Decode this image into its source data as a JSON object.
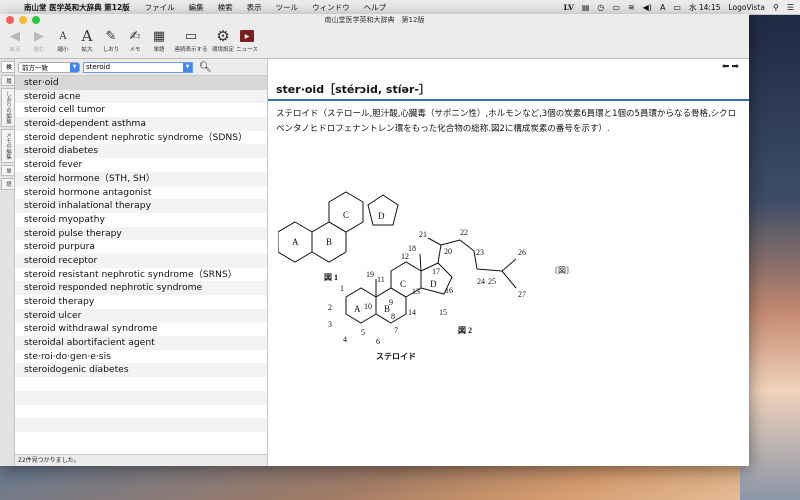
{
  "menubar": {
    "app_name": "南山堂 医学英和大辞典 第12版",
    "menus": [
      "ファイル",
      "編集",
      "検索",
      "表示",
      "ツール",
      "ウィンドウ",
      "ヘルプ"
    ],
    "clock": "水 14:15",
    "right_app": "LogoVista",
    "lv_label": "LV",
    "input_label": "A"
  },
  "window": {
    "title": "南山堂医学英和大辞典　第12版"
  },
  "toolbar": {
    "items": [
      {
        "label": "戻る",
        "icon": "back-arrow-icon"
      },
      {
        "label": "進む",
        "icon": "forward-arrow-icon"
      },
      {
        "label": "縮小",
        "icon": "font-smaller-icon"
      },
      {
        "label": "拡大",
        "icon": "font-larger-icon"
      },
      {
        "label": "しおり",
        "icon": "bookmark-icon"
      },
      {
        "label": "メモ",
        "icon": "memo-icon"
      },
      {
        "label": "単語",
        "icon": "wordbook-icon"
      },
      {
        "label": "連続表示する",
        "icon": "continuous-view-icon"
      },
      {
        "label": "環境設定",
        "icon": "gear-icon"
      },
      {
        "label": "ニュース",
        "icon": "news-icon"
      }
    ]
  },
  "side_tabs": [
    "検",
    "履",
    "しおりの編集",
    "メモの編集",
    "単",
    "語"
  ],
  "search": {
    "mode": "前方一致",
    "query": "steroid"
  },
  "results": [
    "ster·oid",
    "steroid acne",
    "steroid cell tumor",
    "steroid-dependent asthma",
    "steroid dependent nephrotic syndrome（SDNS）",
    "steroid diabetes",
    "steroid fever",
    "steroid hormone（STH, SH）",
    "steroid hormone antagonist",
    "steroid inhalational therapy",
    "steroid myopathy",
    "steroid pulse therapy",
    "steroid purpura",
    "steroid receptor",
    "steroid resistant nephrotic syndrome（SRNS）",
    "steroid responded nephrotic syndrome",
    "steroid therapy",
    "steroid ulcer",
    "steroid withdrawal syndrome",
    "steroidal abortifacient agent",
    "ste·roi·do·gen·e·sis",
    "steroidogenic diabetes"
  ],
  "status": "22件見つかりました。",
  "entry": {
    "headword": "ster·oid［stérɔid, stíər-］",
    "definition": "ステロイド（ステロール,胆汁酸,心臓毒（サポニン性）,ホルモンなど,3個の炭素6員環と1個の5員環からなる骨格,シクロペンタノヒドロフェナントレン環をもった化合物の総称.図2に構成炭素の番号を示す）.",
    "fig1_label": "図 1",
    "fig2_label": "図 2",
    "fig_caption": "ステロイド",
    "fig_side_label": "〔図〕",
    "rings": [
      "A",
      "B",
      "C",
      "D"
    ]
  }
}
